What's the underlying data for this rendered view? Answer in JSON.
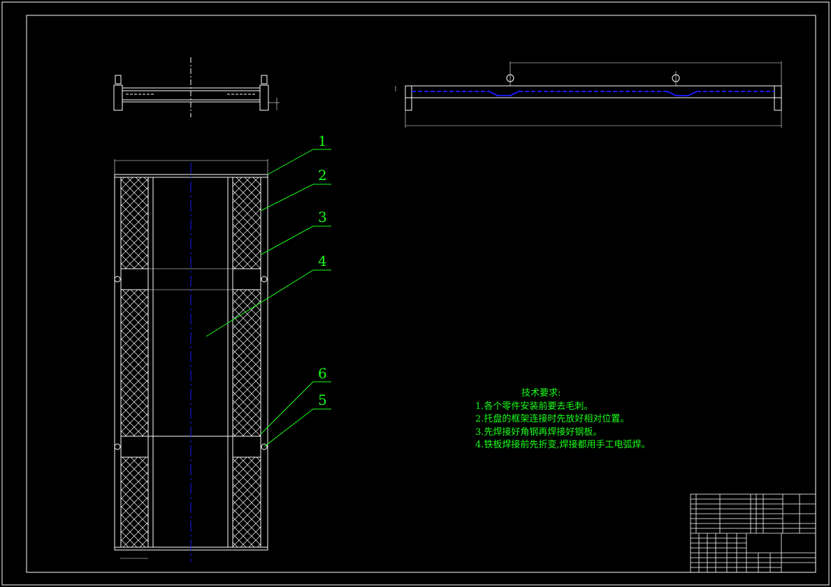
{
  "balloons": [
    {
      "label": "1"
    },
    {
      "label": "2"
    },
    {
      "label": "3"
    },
    {
      "label": "4"
    },
    {
      "label": "6"
    },
    {
      "label": "5"
    }
  ],
  "technical_requirements": {
    "title": "技术要求:",
    "items": [
      "1.各个零件安装前要去毛刺。",
      "2.托盘的框架连接时先放好相对位置。",
      "3.先焊接好角钢再焊接好钢板。",
      "4.铁板焊接前先折变,焊接都用手工电弧焊。"
    ]
  },
  "colors": {
    "background": "#000000",
    "outline": "#ffffff",
    "annotation": "#19ff19",
    "centerline": "#1a1aff"
  }
}
